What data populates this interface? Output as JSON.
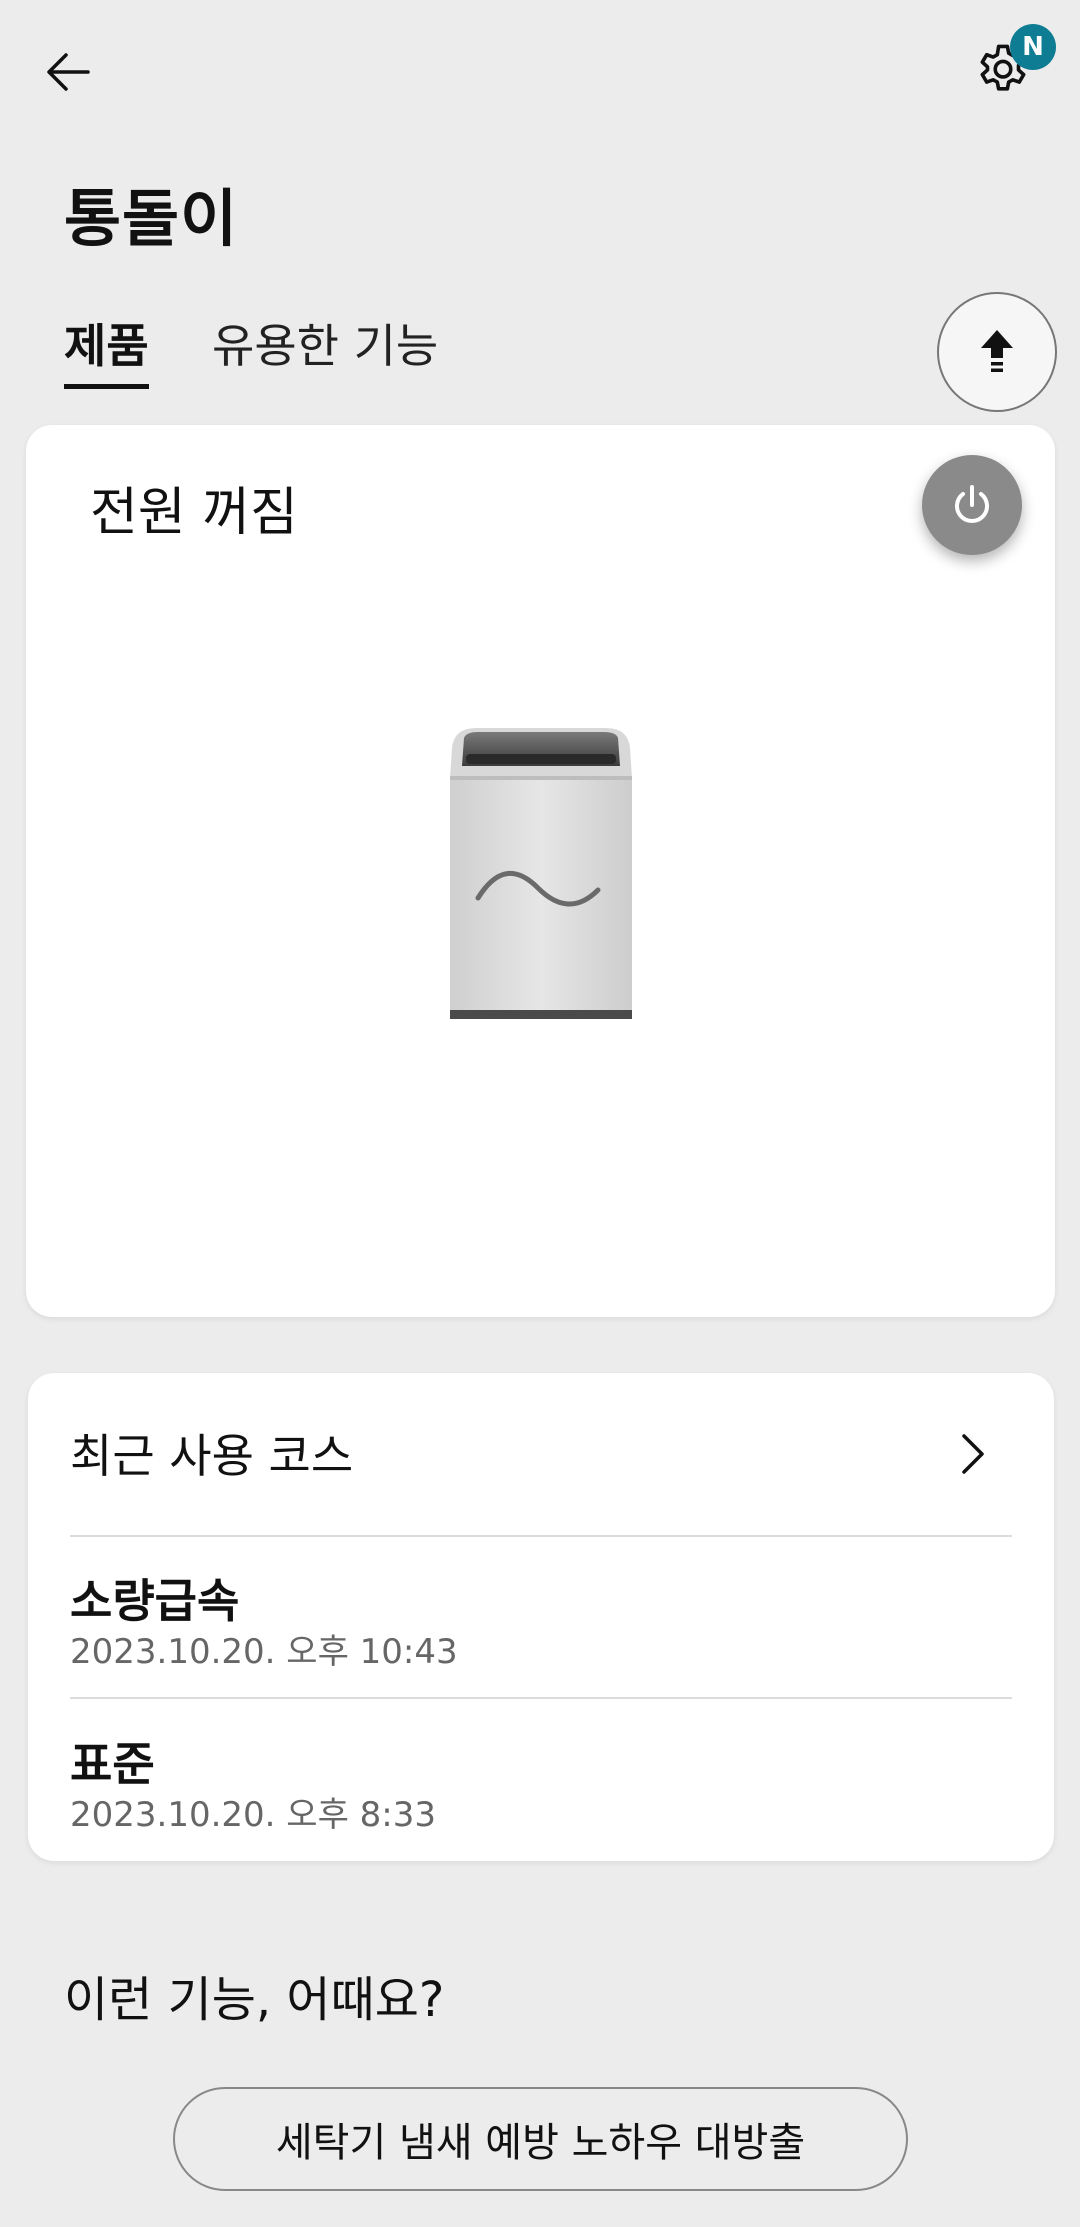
{
  "header": {
    "title": "통돌이",
    "notification_badge": "N"
  },
  "tabs": [
    {
      "label": "제품",
      "active": true
    },
    {
      "label": "유용한 기능",
      "active": false
    }
  ],
  "status_card": {
    "status_text": "전원 꺼짐"
  },
  "recent_courses": {
    "title": "최근 사용 코스",
    "items": [
      {
        "name": "소량급속",
        "date": "2023.10.20. 오후 10:43"
      },
      {
        "name": "표준",
        "date": "2023.10.20. 오후 8:33"
      }
    ]
  },
  "suggestions": {
    "heading": "이런 기능, 어때요?",
    "button_label": "세탁기 냄새 예방 노하우 대방출"
  },
  "colors": {
    "background": "#ececec",
    "badge": "#0e7c93",
    "power_button": "#8a8a8a"
  }
}
